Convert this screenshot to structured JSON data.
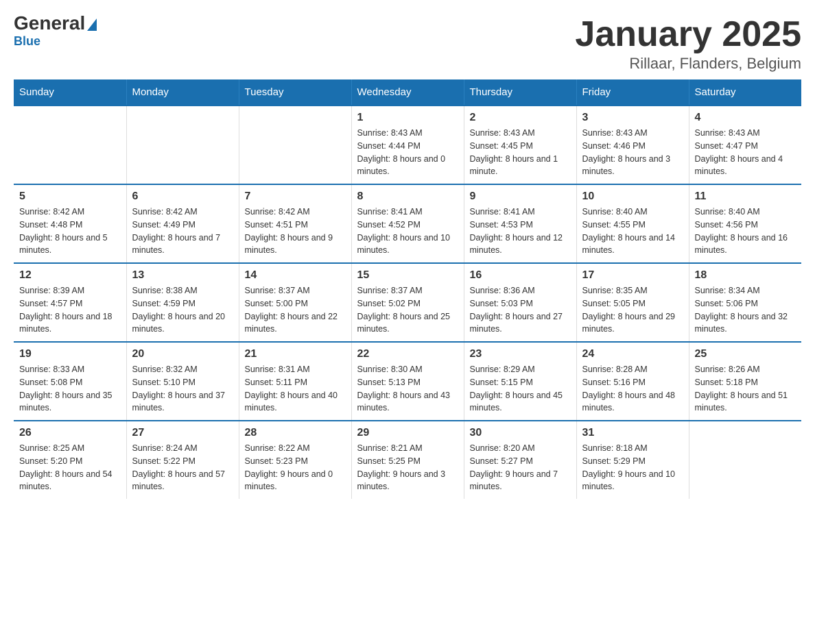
{
  "logo": {
    "text_general": "General",
    "text_blue": "Blue"
  },
  "title": "January 2025",
  "subtitle": "Rillaar, Flanders, Belgium",
  "weekdays": [
    "Sunday",
    "Monday",
    "Tuesday",
    "Wednesday",
    "Thursday",
    "Friday",
    "Saturday"
  ],
  "weeks": [
    [
      {
        "day": "",
        "sunrise": "",
        "sunset": "",
        "daylight": ""
      },
      {
        "day": "",
        "sunrise": "",
        "sunset": "",
        "daylight": ""
      },
      {
        "day": "",
        "sunrise": "",
        "sunset": "",
        "daylight": ""
      },
      {
        "day": "1",
        "sunrise": "Sunrise: 8:43 AM",
        "sunset": "Sunset: 4:44 PM",
        "daylight": "Daylight: 8 hours and 0 minutes."
      },
      {
        "day": "2",
        "sunrise": "Sunrise: 8:43 AM",
        "sunset": "Sunset: 4:45 PM",
        "daylight": "Daylight: 8 hours and 1 minute."
      },
      {
        "day": "3",
        "sunrise": "Sunrise: 8:43 AM",
        "sunset": "Sunset: 4:46 PM",
        "daylight": "Daylight: 8 hours and 3 minutes."
      },
      {
        "day": "4",
        "sunrise": "Sunrise: 8:43 AM",
        "sunset": "Sunset: 4:47 PM",
        "daylight": "Daylight: 8 hours and 4 minutes."
      }
    ],
    [
      {
        "day": "5",
        "sunrise": "Sunrise: 8:42 AM",
        "sunset": "Sunset: 4:48 PM",
        "daylight": "Daylight: 8 hours and 5 minutes."
      },
      {
        "day": "6",
        "sunrise": "Sunrise: 8:42 AM",
        "sunset": "Sunset: 4:49 PM",
        "daylight": "Daylight: 8 hours and 7 minutes."
      },
      {
        "day": "7",
        "sunrise": "Sunrise: 8:42 AM",
        "sunset": "Sunset: 4:51 PM",
        "daylight": "Daylight: 8 hours and 9 minutes."
      },
      {
        "day": "8",
        "sunrise": "Sunrise: 8:41 AM",
        "sunset": "Sunset: 4:52 PM",
        "daylight": "Daylight: 8 hours and 10 minutes."
      },
      {
        "day": "9",
        "sunrise": "Sunrise: 8:41 AM",
        "sunset": "Sunset: 4:53 PM",
        "daylight": "Daylight: 8 hours and 12 minutes."
      },
      {
        "day": "10",
        "sunrise": "Sunrise: 8:40 AM",
        "sunset": "Sunset: 4:55 PM",
        "daylight": "Daylight: 8 hours and 14 minutes."
      },
      {
        "day": "11",
        "sunrise": "Sunrise: 8:40 AM",
        "sunset": "Sunset: 4:56 PM",
        "daylight": "Daylight: 8 hours and 16 minutes."
      }
    ],
    [
      {
        "day": "12",
        "sunrise": "Sunrise: 8:39 AM",
        "sunset": "Sunset: 4:57 PM",
        "daylight": "Daylight: 8 hours and 18 minutes."
      },
      {
        "day": "13",
        "sunrise": "Sunrise: 8:38 AM",
        "sunset": "Sunset: 4:59 PM",
        "daylight": "Daylight: 8 hours and 20 minutes."
      },
      {
        "day": "14",
        "sunrise": "Sunrise: 8:37 AM",
        "sunset": "Sunset: 5:00 PM",
        "daylight": "Daylight: 8 hours and 22 minutes."
      },
      {
        "day": "15",
        "sunrise": "Sunrise: 8:37 AM",
        "sunset": "Sunset: 5:02 PM",
        "daylight": "Daylight: 8 hours and 25 minutes."
      },
      {
        "day": "16",
        "sunrise": "Sunrise: 8:36 AM",
        "sunset": "Sunset: 5:03 PM",
        "daylight": "Daylight: 8 hours and 27 minutes."
      },
      {
        "day": "17",
        "sunrise": "Sunrise: 8:35 AM",
        "sunset": "Sunset: 5:05 PM",
        "daylight": "Daylight: 8 hours and 29 minutes."
      },
      {
        "day": "18",
        "sunrise": "Sunrise: 8:34 AM",
        "sunset": "Sunset: 5:06 PM",
        "daylight": "Daylight: 8 hours and 32 minutes."
      }
    ],
    [
      {
        "day": "19",
        "sunrise": "Sunrise: 8:33 AM",
        "sunset": "Sunset: 5:08 PM",
        "daylight": "Daylight: 8 hours and 35 minutes."
      },
      {
        "day": "20",
        "sunrise": "Sunrise: 8:32 AM",
        "sunset": "Sunset: 5:10 PM",
        "daylight": "Daylight: 8 hours and 37 minutes."
      },
      {
        "day": "21",
        "sunrise": "Sunrise: 8:31 AM",
        "sunset": "Sunset: 5:11 PM",
        "daylight": "Daylight: 8 hours and 40 minutes."
      },
      {
        "day": "22",
        "sunrise": "Sunrise: 8:30 AM",
        "sunset": "Sunset: 5:13 PM",
        "daylight": "Daylight: 8 hours and 43 minutes."
      },
      {
        "day": "23",
        "sunrise": "Sunrise: 8:29 AM",
        "sunset": "Sunset: 5:15 PM",
        "daylight": "Daylight: 8 hours and 45 minutes."
      },
      {
        "day": "24",
        "sunrise": "Sunrise: 8:28 AM",
        "sunset": "Sunset: 5:16 PM",
        "daylight": "Daylight: 8 hours and 48 minutes."
      },
      {
        "day": "25",
        "sunrise": "Sunrise: 8:26 AM",
        "sunset": "Sunset: 5:18 PM",
        "daylight": "Daylight: 8 hours and 51 minutes."
      }
    ],
    [
      {
        "day": "26",
        "sunrise": "Sunrise: 8:25 AM",
        "sunset": "Sunset: 5:20 PM",
        "daylight": "Daylight: 8 hours and 54 minutes."
      },
      {
        "day": "27",
        "sunrise": "Sunrise: 8:24 AM",
        "sunset": "Sunset: 5:22 PM",
        "daylight": "Daylight: 8 hours and 57 minutes."
      },
      {
        "day": "28",
        "sunrise": "Sunrise: 8:22 AM",
        "sunset": "Sunset: 5:23 PM",
        "daylight": "Daylight: 9 hours and 0 minutes."
      },
      {
        "day": "29",
        "sunrise": "Sunrise: 8:21 AM",
        "sunset": "Sunset: 5:25 PM",
        "daylight": "Daylight: 9 hours and 3 minutes."
      },
      {
        "day": "30",
        "sunrise": "Sunrise: 8:20 AM",
        "sunset": "Sunset: 5:27 PM",
        "daylight": "Daylight: 9 hours and 7 minutes."
      },
      {
        "day": "31",
        "sunrise": "Sunrise: 8:18 AM",
        "sunset": "Sunset: 5:29 PM",
        "daylight": "Daylight: 9 hours and 10 minutes."
      },
      {
        "day": "",
        "sunrise": "",
        "sunset": "",
        "daylight": ""
      }
    ]
  ]
}
